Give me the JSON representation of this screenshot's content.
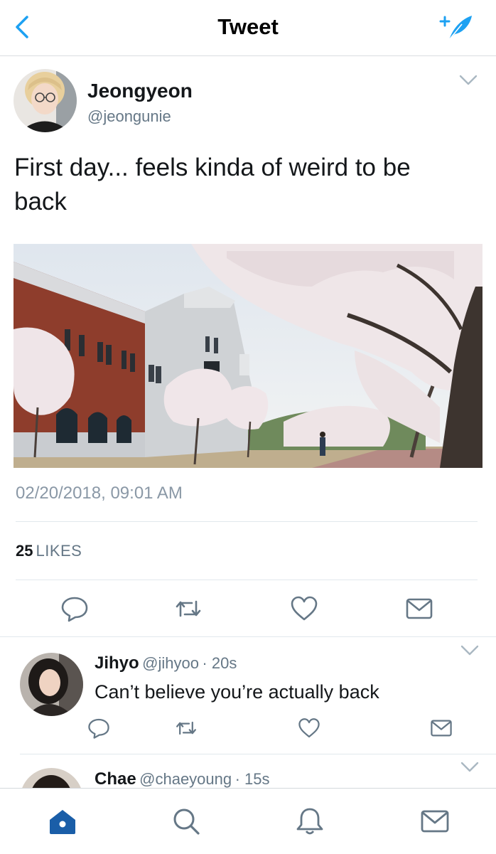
{
  "header": {
    "title": "Tweet",
    "back_icon": "chevron-left-icon",
    "compose_icon": "compose-feather-icon"
  },
  "tweet": {
    "author_name": "Jeongyeon",
    "author_handle": "@jeongunie",
    "text": "First day... feels kinda of weird to be back",
    "photo": "campus building with cherry blossom trees",
    "timestamp": "02/20/2018, 09:01 AM",
    "likes_count": "25",
    "likes_label": "LIKES",
    "actions": [
      "reply-icon",
      "retweet-icon",
      "like-icon",
      "direct-message-icon"
    ]
  },
  "replies": [
    {
      "name": "Jihyo",
      "handle": "@jihyoo",
      "time": "· 20s",
      "text": "Can’t believe you’re actually back"
    },
    {
      "name": "Chae",
      "handle": "@chaeyoung",
      "time": "· 15s",
      "text": ""
    }
  ],
  "tabbar": {
    "items": [
      "home-icon",
      "search-icon",
      "notifications-bell-icon",
      "messages-envelope-icon"
    ],
    "active": "home-icon"
  },
  "colors": {
    "accent": "#1da1f2",
    "active_tab": "#1a5ea8",
    "secondary_text": "#657786"
  }
}
